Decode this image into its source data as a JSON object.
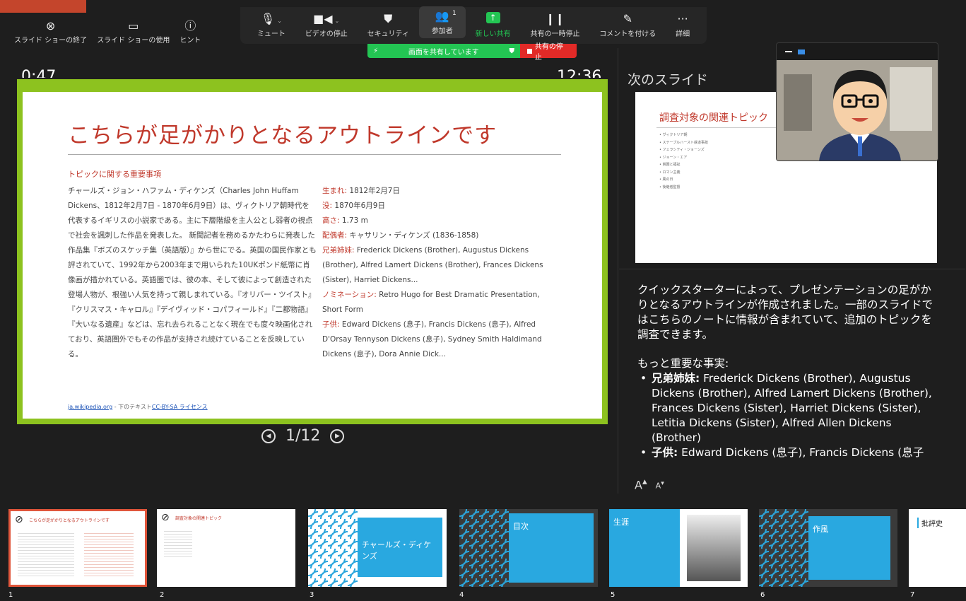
{
  "presenter_tools": [
    {
      "icon": "close-circle-icon",
      "glyph": "⊗",
      "label": "スライド ショーの終了"
    },
    {
      "icon": "display-icon",
      "glyph": "▭",
      "label": "スライド ショーの使用"
    },
    {
      "icon": "info-icon",
      "glyph": "ⓘ",
      "label": "ヒント"
    }
  ],
  "toolbar": {
    "mute": "ミュート",
    "video": "ビデオの停止",
    "security": "セキュリティ",
    "participants": "参加者",
    "participants_count": "1",
    "new_share": "新しい共有",
    "pause_share": "共有の一時停止",
    "annotate": "コメントを付ける",
    "more": "詳細"
  },
  "sharing": {
    "status": "画面を共有しています",
    "stop": "共有の停止"
  },
  "timer": "0:47",
  "clock": "12:36",
  "slide": {
    "title": "こちらが足がかりとなるアウトラインです",
    "subtitle": "トピックに関する重要事項",
    "body_left": "チャールズ・ジョン・ハファム・ディケンズ（Charles John Huffam Dickens、1812年2月7日 - 1870年6月9日）は、ヴィクトリア朝時代を代表するイギリスの小説家である。主に下層階級を主人公とし弱者の視点で社会を諷刺した作品を発表した。 新聞記者を務めるかたわらに発表した作品集『ボズのスケッチ集（英語版）』から世にでる。英国の国民作家とも評されていて、1992年から2003年まで用いられた10UKポンド紙幣に肖像画が描かれている。英語圏では、彼の本、そして彼によって創造された登場人物が、根強い人気を持って親しまれている。『オリバー・ツイスト』『クリスマス・キャロル』『デイヴィッド・コパフィールド』『二都物語』『大いなる遺産』などは、忘れ去られることなく現在でも度々映画化されており、英語圏外でもその作品が支持され続けていることを反映している。",
    "facts": [
      {
        "k": "生まれ:",
        "v": " 1812年2月7日"
      },
      {
        "k": "没:",
        "v": " 1870年6月9日"
      },
      {
        "k": "高さ:",
        "v": " 1.73 m"
      },
      {
        "k": "配偶者:",
        "v": " キャサリン・ディケンズ (1836-1858)"
      },
      {
        "k": "兄弟姉妹:",
        "v": " Frederick Dickens (Brother), Augustus Dickens (Brother), Alfred Lamert Dickens (Brother), Frances Dickens (Sister), Harriet Dickens..."
      },
      {
        "k": "ノミネーション:",
        "v": " Retro Hugo for Best Dramatic Presentation, Short Form"
      },
      {
        "k": "子供:",
        "v": " Edward Dickens (息子), Francis Dickens (息子), Alfred D'Orsay Tennyson Dickens (息子), Sydney Smith Haldimand Dickens (息子), Dora Annie Dick..."
      }
    ],
    "source_site": "ja.wikipedia.org",
    "source_mid": " - 下のテキスト",
    "source_license": "CC-BY-SA ライセンス"
  },
  "pager": {
    "current": "1",
    "sep": "/",
    "total": "12"
  },
  "next_slide": {
    "label": "次のスライド",
    "title": "調査対象の関連トピック",
    "items": [
      "ヴィクトリア朝",
      "ステープルハースト鉄道事故",
      "フェラシティ・ジョーンズ",
      "ジョーン・エア",
      "貧困と福祉",
      "ロマン主義",
      "風の日",
      "後継者監督"
    ]
  },
  "notes": {
    "p1": "クイックスターターによって、プレゼンテーションの足がかりとなるアウトラインが作成されました。一部のスライドではこちらのノートに情報が含まれていて、追加のトピックを調査できます。",
    "p2": "もっと重要な事実:",
    "b1_key": "兄弟姉妹:",
    "b1_val": " Frederick Dickens (Brother), Augustus Dickens (Brother), Alfred Lamert Dickens (Brother), Frances Dickens (Sister), Harriet Dickens (Sister), Letitia Dickens (Sister), Alfred Allen Dickens (Brother)",
    "b2_key": "子供:",
    "b2_val": " Edward Dickens (息子), Francis Dickens (息子"
  },
  "font_controls": {
    "larger": "A",
    "smaller": "A"
  },
  "thumbnails": [
    {
      "num": "1",
      "text": "こちらが足がかりとなるアウトラインです"
    },
    {
      "num": "2",
      "text": "調査対象の関連トピック"
    },
    {
      "num": "3",
      "text": "チャールズ・ディケンズ"
    },
    {
      "num": "4",
      "text": "目次"
    },
    {
      "num": "5",
      "text": "生涯"
    },
    {
      "num": "6",
      "text": "作風"
    },
    {
      "num": "7",
      "text": "批評史"
    }
  ]
}
